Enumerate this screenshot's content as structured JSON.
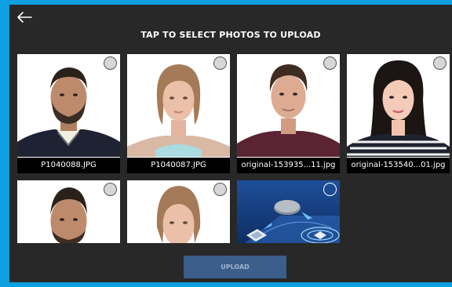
{
  "header": {
    "title": "TAP TO SELECT PHOTOS TO UPLOAD",
    "back_icon": "arrow-left-icon"
  },
  "photos": [
    {
      "caption": "P1040088.JPG"
    },
    {
      "caption": "P1040087.JPG"
    },
    {
      "caption": "original-153935...11.jpg"
    },
    {
      "caption": "original-153540...01.jpg"
    }
  ],
  "footer": {
    "upload_label": "UPLOAD"
  },
  "colors": {
    "frame": "#0d9fe0",
    "background": "#282828",
    "upload_button": "#3b5e8a"
  }
}
